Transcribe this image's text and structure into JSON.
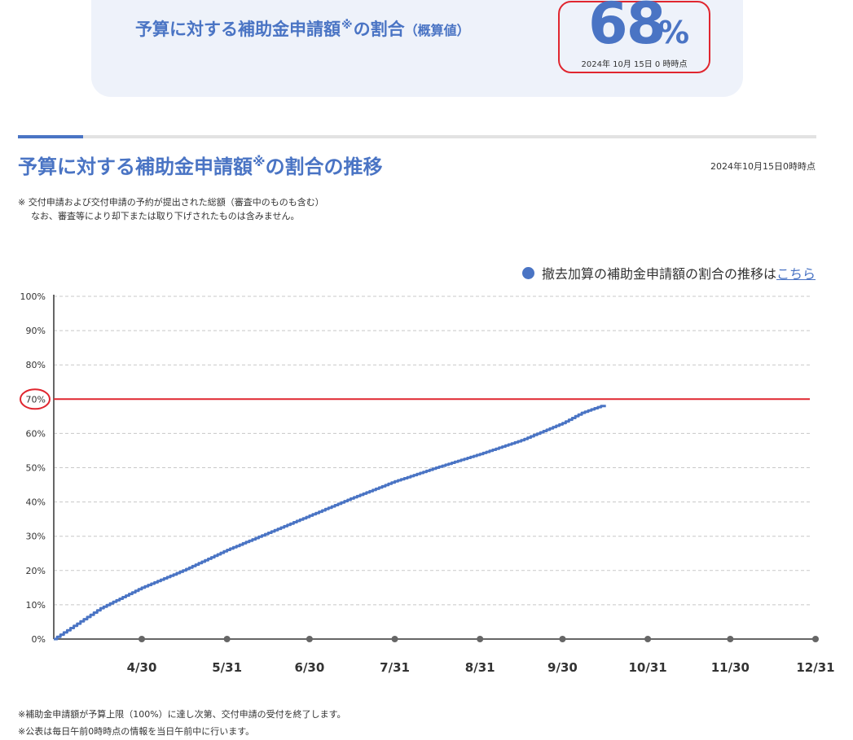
{
  "header": {
    "title_main": "予算に対する補助金申請額",
    "title_mark": "※",
    "title_tail": "の割合",
    "title_sub": "（概算値）",
    "percent_value": "68",
    "percent_unit": "%",
    "as_of": "2024年 10月 15日 0 時時点"
  },
  "section": {
    "title_main": "予算に対する補助金申請額",
    "title_mark": "※",
    "title_tail": "の割合の推移",
    "as_of": "2024年10月15日0時時点",
    "note_line1": "※ 交付申請および交付申請の予約が提出された総額（審査中のものも含む）",
    "note_line2": "なお、審査等により却下または取り下げされたものは含みません。"
  },
  "legend": {
    "text": "撤去加算の補助金申請額の割合の推移は",
    "link": "こちら"
  },
  "footer": {
    "note1": "※補助金申請額が予算上限（100%）に達し次第、交付申請の受付を終了します。",
    "note2": "※公表は毎日午前0時時点の情報を当日午前中に行います。"
  },
  "colors": {
    "accent": "#4a74c4",
    "highlight": "#e0262f",
    "grid": "#c8c8c8",
    "axis": "#666666"
  },
  "chart_data": {
    "type": "line",
    "title": "",
    "xlabel": "",
    "ylabel": "",
    "y_tick_labels": [
      "0%",
      "10%",
      "20%",
      "30%",
      "40%",
      "50%",
      "60%",
      "70%",
      "80%",
      "90%",
      "100%"
    ],
    "ylim": [
      0,
      100
    ],
    "x_tick_labels": [
      "4/30",
      "5/31",
      "6/30",
      "7/31",
      "8/31",
      "9/30",
      "10/31",
      "11/30",
      "12/31"
    ],
    "x_tick_dates": [
      "2024-04-30",
      "2024-05-31",
      "2024-06-30",
      "2024-07-31",
      "2024-08-31",
      "2024-09-30",
      "2024-10-31",
      "2024-11-30",
      "2024-12-31"
    ],
    "xlim": [
      "2024-03-29",
      "2024-12-31"
    ],
    "grid": true,
    "reference_line": {
      "y": 70,
      "highlighted_tick": "70%"
    },
    "series": [
      {
        "values_x": [
          "2024-03-29",
          "2024-04-15",
          "2024-04-30",
          "2024-05-15",
          "2024-05-31",
          "2024-06-15",
          "2024-06-30",
          "2024-07-15",
          "2024-07-31",
          "2024-08-15",
          "2024-08-31",
          "2024-09-15",
          "2024-09-30",
          "2024-10-07",
          "2024-10-14"
        ],
        "values_y": [
          0,
          9,
          15,
          20,
          26,
          31,
          36,
          41,
          46,
          50,
          54,
          58,
          63,
          66,
          68
        ]
      }
    ]
  }
}
